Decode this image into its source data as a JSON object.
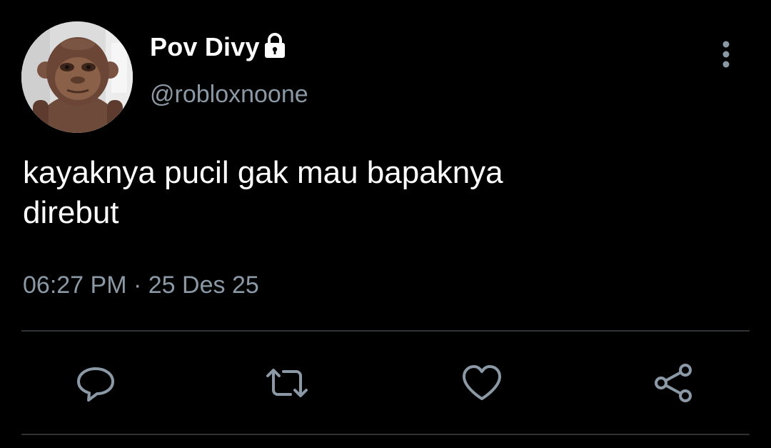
{
  "author": {
    "display_name": "Pov Divy",
    "handle": "@robloxnoone",
    "protected_icon": "lock-icon",
    "avatar": "avatar"
  },
  "tweet": {
    "text_line_1": "kayaknya pucil gak mau bapaknya",
    "text_line_2": "direbut",
    "time": "06:27 PM",
    "separator": "·",
    "date": "25 Des 25"
  },
  "actions": [
    {
      "name": "reply",
      "icon": "reply-icon"
    },
    {
      "name": "retweet",
      "icon": "retweet-icon"
    },
    {
      "name": "like",
      "icon": "heart-icon"
    },
    {
      "name": "share",
      "icon": "share-icon"
    }
  ],
  "menu_icon": "more-vertical-icon",
  "colors": {
    "background": "#000000",
    "primary_text": "#ffffff",
    "secondary_text": "#8b98a5",
    "divider": "#2f3336"
  }
}
